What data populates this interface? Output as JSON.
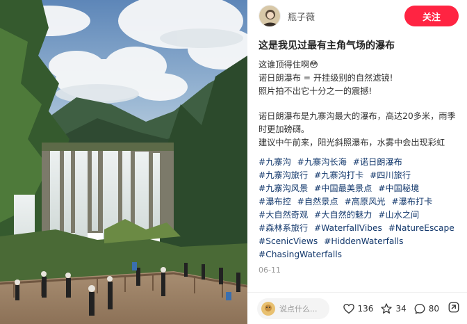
{
  "author": {
    "name": "瓶子薇",
    "follow_label": "关注"
  },
  "note": {
    "title": "这是我见过最有主角气场的瀑布",
    "paragraphs": [
      "这谁顶得住啊😳\n诺日朗瀑布 = 开挂级别的自然滤镜!\n照片拍不出它十分之一的震撼!",
      "诺日朗瀑布是九寨沟最大的瀑布，高达20多米，雨季时更加磅礴。\n建议中午前来，阳光斜照瀑布，水雾中会出现彩虹"
    ],
    "tags": [
      "#九寨沟",
      "#九寨沟长海",
      "#诺日朗瀑布",
      "#九寨沟旅行",
      "#九寨沟打卡",
      "#四川旅行",
      "#九寨沟风景",
      "#中国最美景点",
      "#中国秘境",
      "#瀑布控",
      "#自然景点",
      "#高原风光",
      "#瀑布打卡",
      "#大自然奇观",
      "#大自然的魅力",
      "#山水之间",
      "#森林系旅行",
      "#WaterfallVibes",
      "#NatureEscape",
      "#ScenicViews",
      "#HiddenWaterfalls",
      "#ChasingWaterfalls"
    ],
    "date": "06-11"
  },
  "engage": {
    "comment_placeholder": "说点什么...",
    "likes": "136",
    "collects": "34",
    "comments": "80"
  },
  "colors": {
    "accent": "#ff2442",
    "tag": "#13386c"
  },
  "icons": {
    "like": "heart-icon",
    "collect": "star-icon",
    "comment": "chat-bubble-icon",
    "share": "share-icon"
  }
}
